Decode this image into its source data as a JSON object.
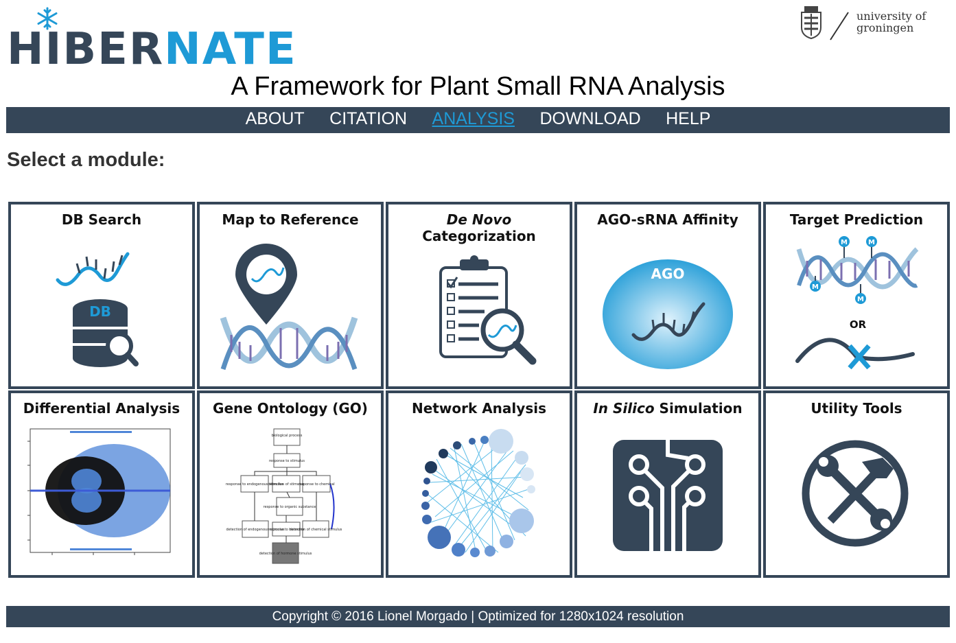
{
  "logo": {
    "part1": "HIBER",
    "part2": "NATE"
  },
  "university": {
    "line1": "university of",
    "line2": "groningen"
  },
  "subtitle": "A Framework for Plant Small RNA Analysis",
  "nav": {
    "items": [
      {
        "label": "ABOUT"
      },
      {
        "label": "CITATION"
      },
      {
        "label": "ANALYSIS",
        "active": true
      },
      {
        "label": "DOWNLOAD"
      },
      {
        "label": "HELP"
      }
    ]
  },
  "heading": "Select a module:",
  "modules": {
    "db_search": {
      "title": "DB Search",
      "icon_text": "DB"
    },
    "map_reference": {
      "title": "Map to Reference"
    },
    "de_novo": {
      "title_em": "De Novo",
      "title_rest": " Categorization"
    },
    "ago": {
      "title": "AGO-sRNA Affinity",
      "icon_text": "AGO"
    },
    "target": {
      "title": "Target Prediction",
      "or_text": "OR",
      "marker": "M"
    },
    "differential": {
      "title": "Differential Analysis"
    },
    "go": {
      "title": "Gene Ontology (GO)",
      "nodes": {
        "n1": "biological process",
        "n2": "response to stimulus",
        "n3": "response to endogenous stimulus",
        "n4": "detection of stimulus",
        "n5": "response to chemical",
        "n6": "response to organic substance",
        "n7": "detection of endogenous stimulus",
        "n8": "response to hormone",
        "n9": "detection of chemical stimulus",
        "n10": "detection of hormone stimulus"
      }
    },
    "network": {
      "title": "Network Analysis"
    },
    "in_silico": {
      "title_em": "In Silico",
      "title_rest": " Simulation"
    },
    "utility": {
      "title": "Utility Tools"
    }
  },
  "colors": {
    "navy": "#354658",
    "blue": "#1e9ad6",
    "light_blue": "#9fc3dd"
  },
  "footer": "Copyright © 2016 Lionel Morgado | Optimized for 1280x1024 resolution"
}
